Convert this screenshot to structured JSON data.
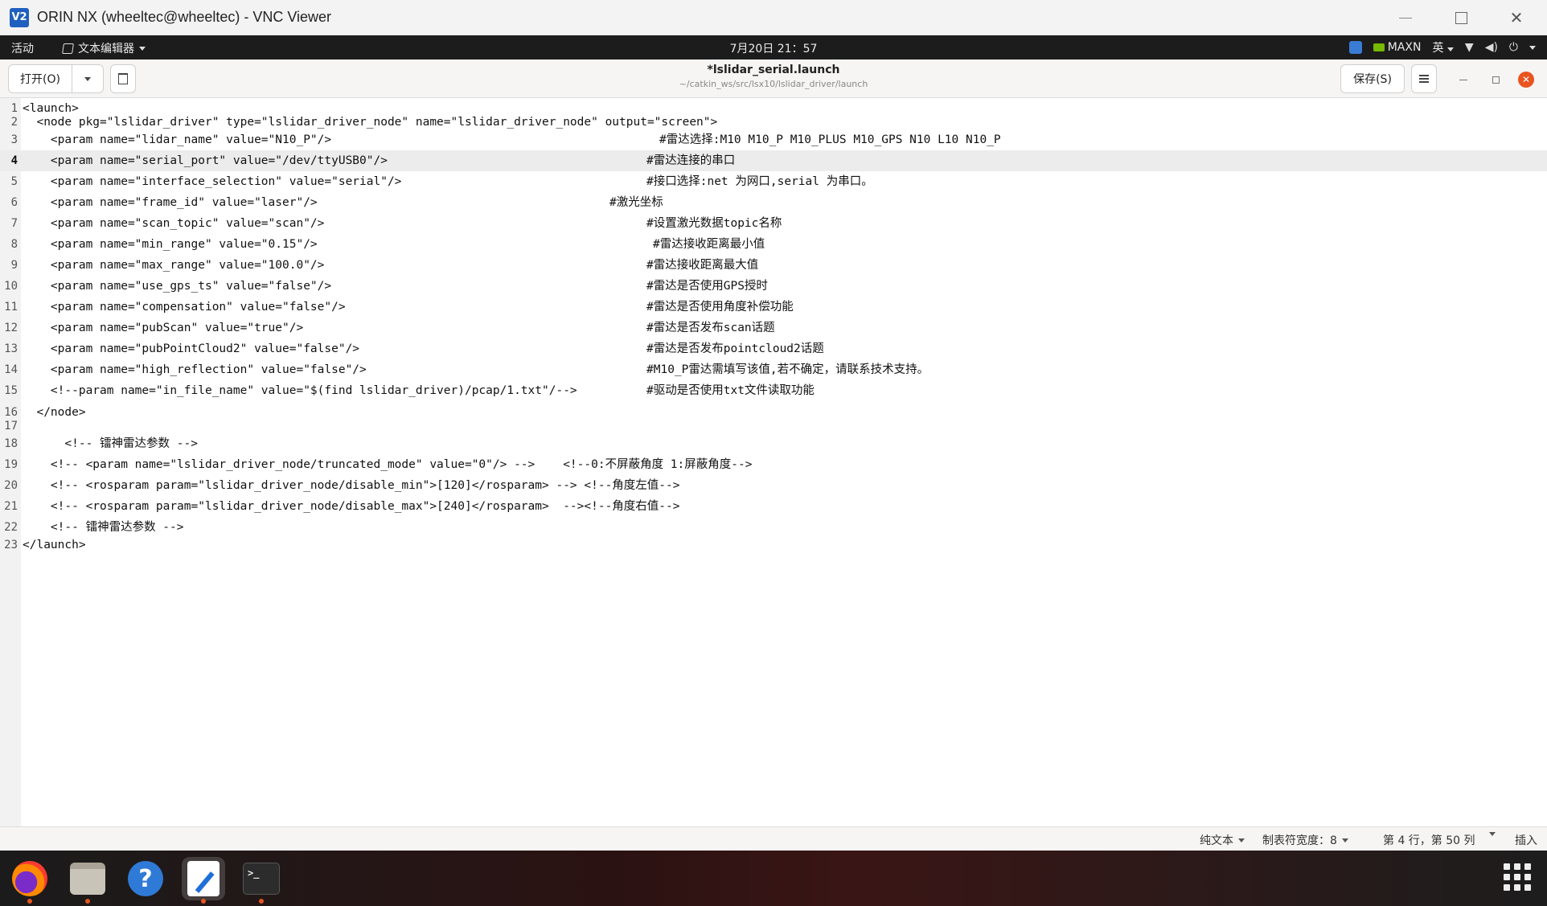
{
  "vnc": {
    "title": "ORIN NX (wheeltec@wheeltec) - VNC Viewer",
    "logo": "V2",
    "minimize_icon": "minimize-icon",
    "maximize_icon": "maximize-icon",
    "close_icon": "close-icon",
    "close_glyph": "✕"
  },
  "topbar": {
    "activities": "活动",
    "app_name": "文本编辑器",
    "clock": "7月20日  21：57",
    "power_mode": "MAXN",
    "input_method": "英",
    "wifi_glyph": "▼",
    "volume_glyph": "◀)",
    "power_glyph": "⏻"
  },
  "header": {
    "open_label": "打开(O)",
    "doc_title": "*lslidar_serial.launch",
    "doc_path": "~/catkin_ws/src/lsx10/lslidar_driver/launch",
    "save_label": "保存(S)",
    "close_glyph": "✕"
  },
  "editor": {
    "current_line": 4,
    "lines": [
      {
        "n": "1",
        "code": "<launch>",
        "comment": ""
      },
      {
        "n": "2",
        "code": "  <node pkg=\"lslidar_driver\" type=\"lslidar_driver_node\" name=\"lslidar_driver_node\" output=\"screen\">",
        "comment": ""
      },
      {
        "n": "3",
        "code": "    <param name=\"lidar_name\" value=\"N10_P\"/>",
        "comment": "#雷达选择:M10 M10_P M10_PLUS M10_GPS N10 L10 N10_P"
      },
      {
        "n": "4",
        "code": "    <param name=\"serial_port\" value=\"/dev/ttyUSB0\"/>",
        "comment": "#雷达连接的串口"
      },
      {
        "n": "5",
        "code": "    <param name=\"interface_selection\" value=\"serial\"/>",
        "comment": "#接口选择:net 为网口,serial 为串口。"
      },
      {
        "n": "6",
        "code": "    <param name=\"frame_id\" value=\"laser\"/>",
        "comment": "#激光坐标"
      },
      {
        "n": "7",
        "code": "    <param name=\"scan_topic\" value=\"scan\"/>",
        "comment": "#设置激光数据topic名称"
      },
      {
        "n": "8",
        "code": "    <param name=\"min_range\" value=\"0.15\"/>",
        "comment": "#雷达接收距离最小值"
      },
      {
        "n": "9",
        "code": "    <param name=\"max_range\" value=\"100.0\"/>",
        "comment": "#雷达接收距离最大值"
      },
      {
        "n": "10",
        "code": "    <param name=\"use_gps_ts\" value=\"false\"/>",
        "comment": "#雷达是否使用GPS授时"
      },
      {
        "n": "11",
        "code": "    <param name=\"compensation\" value=\"false\"/>",
        "comment": "#雷达是否使用角度补偿功能"
      },
      {
        "n": "12",
        "code": "    <param name=\"pubScan\" value=\"true\"/>",
        "comment": "#雷达是否发布scan话题"
      },
      {
        "n": "13",
        "code": "    <param name=\"pubPointCloud2\" value=\"false\"/>",
        "comment": "#雷达是否发布pointcloud2话题"
      },
      {
        "n": "14",
        "code": "    <param name=\"high_reflection\" value=\"false\"/>",
        "comment": "#M10_P雷达需填写该值,若不确定，请联系技术支持。"
      },
      {
        "n": "15",
        "code": "    <!--param name=\"in_file_name\" value=\"$(find lslidar_driver)/pcap/1.txt\"/-->",
        "comment": "#驱动是否使用txt文件读取功能"
      },
      {
        "n": "16",
        "code": "  </node>",
        "comment": ""
      },
      {
        "n": "17",
        "code": "",
        "comment": ""
      },
      {
        "n": "18",
        "code": "      <!-- 镭神雷达参数 -->",
        "comment": ""
      },
      {
        "n": "19",
        "code": "    <!-- <param name=\"lslidar_driver_node/truncated_mode\" value=\"0\"/> -->    <!--0:不屏蔽角度 1:屏蔽角度-->",
        "comment": ""
      },
      {
        "n": "20",
        "code": "    <!-- <rosparam param=\"lslidar_driver_node/disable_min\">[120]</rosparam> --> <!--角度左值-->",
        "comment": ""
      },
      {
        "n": "21",
        "code": "    <!-- <rosparam param=\"lslidar_driver_node/disable_max\">[240]</rosparam>  --><!--角度右值-->",
        "comment": ""
      },
      {
        "n": "22",
        "code": "    <!-- 镭神雷达参数 -->",
        "comment": ""
      },
      {
        "n": "23",
        "code": "</launch>",
        "comment": ""
      }
    ]
  },
  "statusbar": {
    "syntax": "纯文本",
    "tab_width": "制表符宽度：8",
    "cursor_pos": "第 4 行，第 50 列",
    "mode": "插入"
  },
  "dock": {
    "terminal_prompt": ">_",
    "help_glyph": "?",
    "apps": [
      "firefox-icon",
      "files-icon",
      "help-icon",
      "text-editor-icon",
      "terminal-icon"
    ]
  },
  "colors": {
    "accent": "#e95420",
    "topbar": "#1c1c1c"
  }
}
